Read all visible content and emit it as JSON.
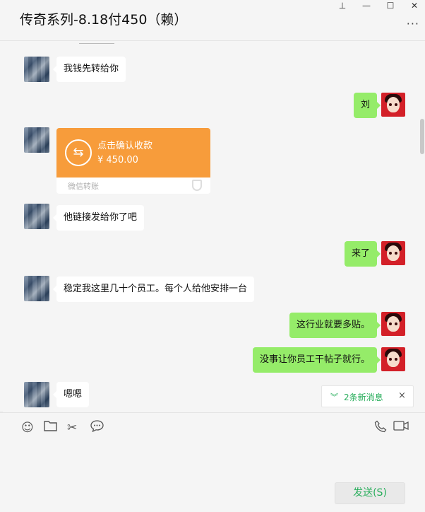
{
  "window": {
    "title": "传奇系列-8.18付450（赖）",
    "controls": {
      "pin": "⊥",
      "minimize": "—",
      "maximize": "☐",
      "close": "✕"
    },
    "more": "···"
  },
  "messages": [
    {
      "side": "left",
      "text": "我钱先转给你"
    },
    {
      "side": "right",
      "text": "刘"
    },
    {
      "side": "left",
      "type": "transfer",
      "title": "点击确认收款",
      "amount": "¥ 450.00",
      "footer": "微信转账"
    },
    {
      "side": "left",
      "text": "他链接发给你了吧"
    },
    {
      "side": "right",
      "text": "来了"
    },
    {
      "side": "left",
      "text": "稳定我这里几十个员工。每个人给他安排一台"
    },
    {
      "side": "right",
      "text": "这行业就要多贴。"
    },
    {
      "side": "right",
      "text": "没事让你员工干帖子就行。"
    },
    {
      "side": "left",
      "text": "嗯嗯"
    }
  ],
  "new_messages": {
    "label": "2条新消息",
    "icon": "chevrons-down-icon",
    "close": "×"
  },
  "toolbar": {
    "emoji": "☺",
    "folder": "folder-icon",
    "scissors": "✂",
    "chat": "chat-bubble-icon",
    "phone": "phone-icon",
    "video": "video-icon"
  },
  "send_button": "发送(S)",
  "colors": {
    "own_bubble": "#95ec69",
    "transfer": "#f79c3b",
    "accent_green": "#29ae5c",
    "other_bubble": "#ffffff"
  }
}
